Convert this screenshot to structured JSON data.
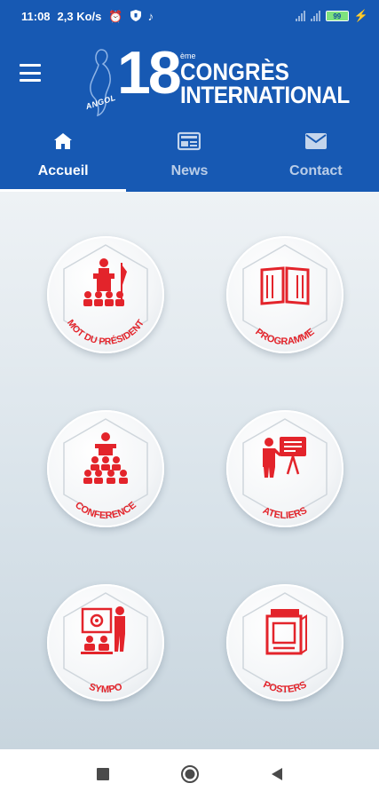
{
  "status_bar": {
    "time": "11:08",
    "speed": "2,3 Ko/s",
    "battery_level": "99"
  },
  "header": {
    "logo": {
      "number": "18",
      "superscript": "ème",
      "line1": "CONGRÈS",
      "line2": "INTERNATIONAL",
      "brand": "ANGOL"
    },
    "tabs": [
      {
        "label": "Accueil",
        "icon": "home-icon",
        "active": true
      },
      {
        "label": "News",
        "icon": "newspaper-icon",
        "active": false
      },
      {
        "label": "Contact",
        "icon": "mail-icon",
        "active": false
      }
    ]
  },
  "tiles": [
    {
      "label": "MOT DU PRÉSIDENT",
      "icon": "president-podium-icon"
    },
    {
      "label": "PROGRAMME",
      "icon": "open-book-icon"
    },
    {
      "label": "CONFERENCE",
      "icon": "conference-icon"
    },
    {
      "label": "ATELIERS",
      "icon": "presenter-board-icon"
    },
    {
      "label": "SYMPO",
      "icon": "symposium-icon"
    },
    {
      "label": "POSTERS",
      "icon": "poster-icon"
    }
  ],
  "colors": {
    "primary": "#1759b3",
    "accent": "#e3242b"
  }
}
